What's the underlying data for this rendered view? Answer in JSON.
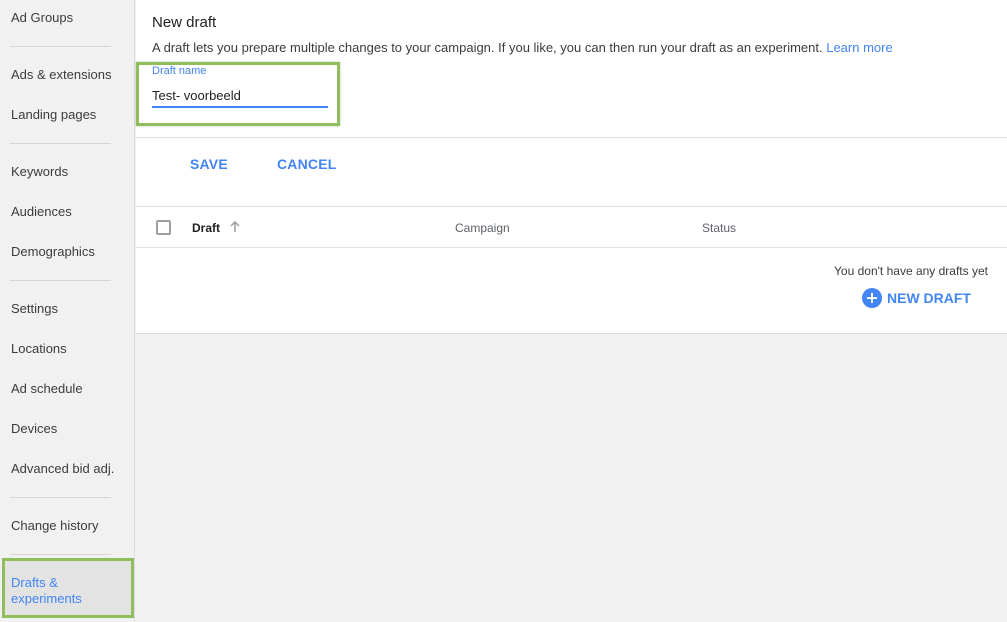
{
  "sidebar": {
    "items": [
      {
        "label": "Ad Groups"
      },
      {
        "label": "Ads & extensions"
      },
      {
        "label": "Landing pages"
      },
      {
        "label": "Keywords"
      },
      {
        "label": "Audiences"
      },
      {
        "label": "Demographics"
      },
      {
        "label": "Settings"
      },
      {
        "label": "Locations"
      },
      {
        "label": "Ad schedule"
      },
      {
        "label": "Devices"
      },
      {
        "label": "Advanced bid adj."
      },
      {
        "label": "Change history"
      }
    ],
    "active_item": {
      "label_line1": "Drafts &",
      "label_line2": "experiments"
    }
  },
  "main": {
    "title": "New draft",
    "description": "A draft lets you prepare multiple changes to your campaign. If you like, you can then run your draft as an experiment.",
    "learn_more": "Learn more",
    "field": {
      "label": "Draft name",
      "value": "Test- voorbeeld"
    },
    "buttons": {
      "save": "SAVE",
      "cancel": "CANCEL"
    }
  },
  "table": {
    "columns": [
      "Draft",
      "Campaign",
      "Status"
    ],
    "sort_column": "Draft",
    "sort_direction": "ascending",
    "empty_message": "You don't have any drafts yet",
    "new_draft_label": "NEW DRAFT"
  },
  "colors": {
    "accent": "#4285f4",
    "highlight": "#8fbe5a"
  }
}
